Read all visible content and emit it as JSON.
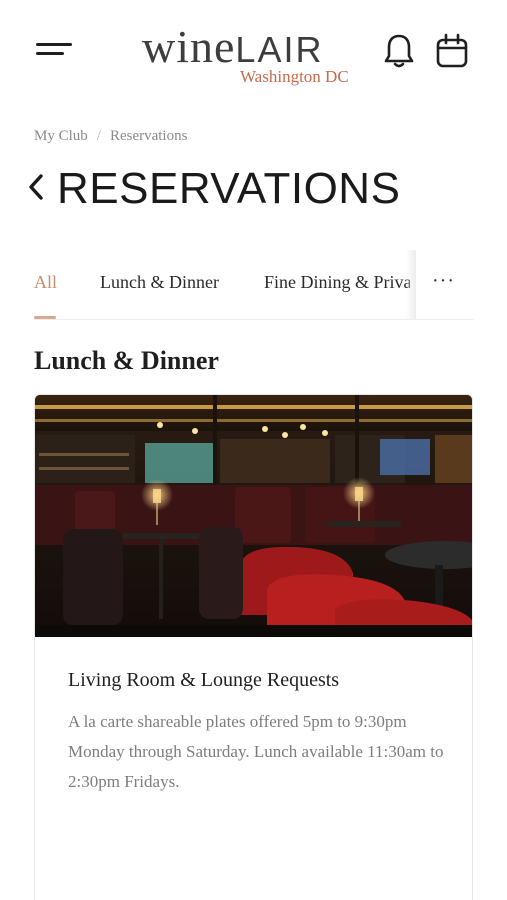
{
  "header": {
    "logo_main_wine": "wine",
    "logo_main_lair": "LAIR",
    "logo_sub": "Washington DC",
    "menu_icon": "hamburger-icon",
    "notifications_icon": "bell-icon",
    "calendar_icon": "calendar-icon"
  },
  "breadcrumb": {
    "items": [
      {
        "label": "My Club"
      },
      {
        "label": "Reservations"
      }
    ],
    "separator": "/"
  },
  "page": {
    "title": "RESERVATIONS",
    "back_icon": "chevron-left-icon"
  },
  "tabs": {
    "items": [
      {
        "label": "All",
        "active": true
      },
      {
        "label": "Lunch & Dinner",
        "active": false
      },
      {
        "label": "Fine Dining & Priva",
        "active": false
      }
    ],
    "more_label": "···",
    "accent_color": "#c98a6a"
  },
  "section": {
    "title": "Lunch & Dinner"
  },
  "card": {
    "image_description": "restaurant-interior-photo",
    "title": "Living Room & Lounge Requests",
    "description": "A la carte shareable plates offered 5pm to 9:30pm Monday through Saturday. Lunch available 11:30am to 2:30pm Fridays."
  },
  "colors": {
    "brand_accent": "#c86a4f",
    "text_dark": "#1f1f1f",
    "text_muted": "#7d7d7d"
  }
}
